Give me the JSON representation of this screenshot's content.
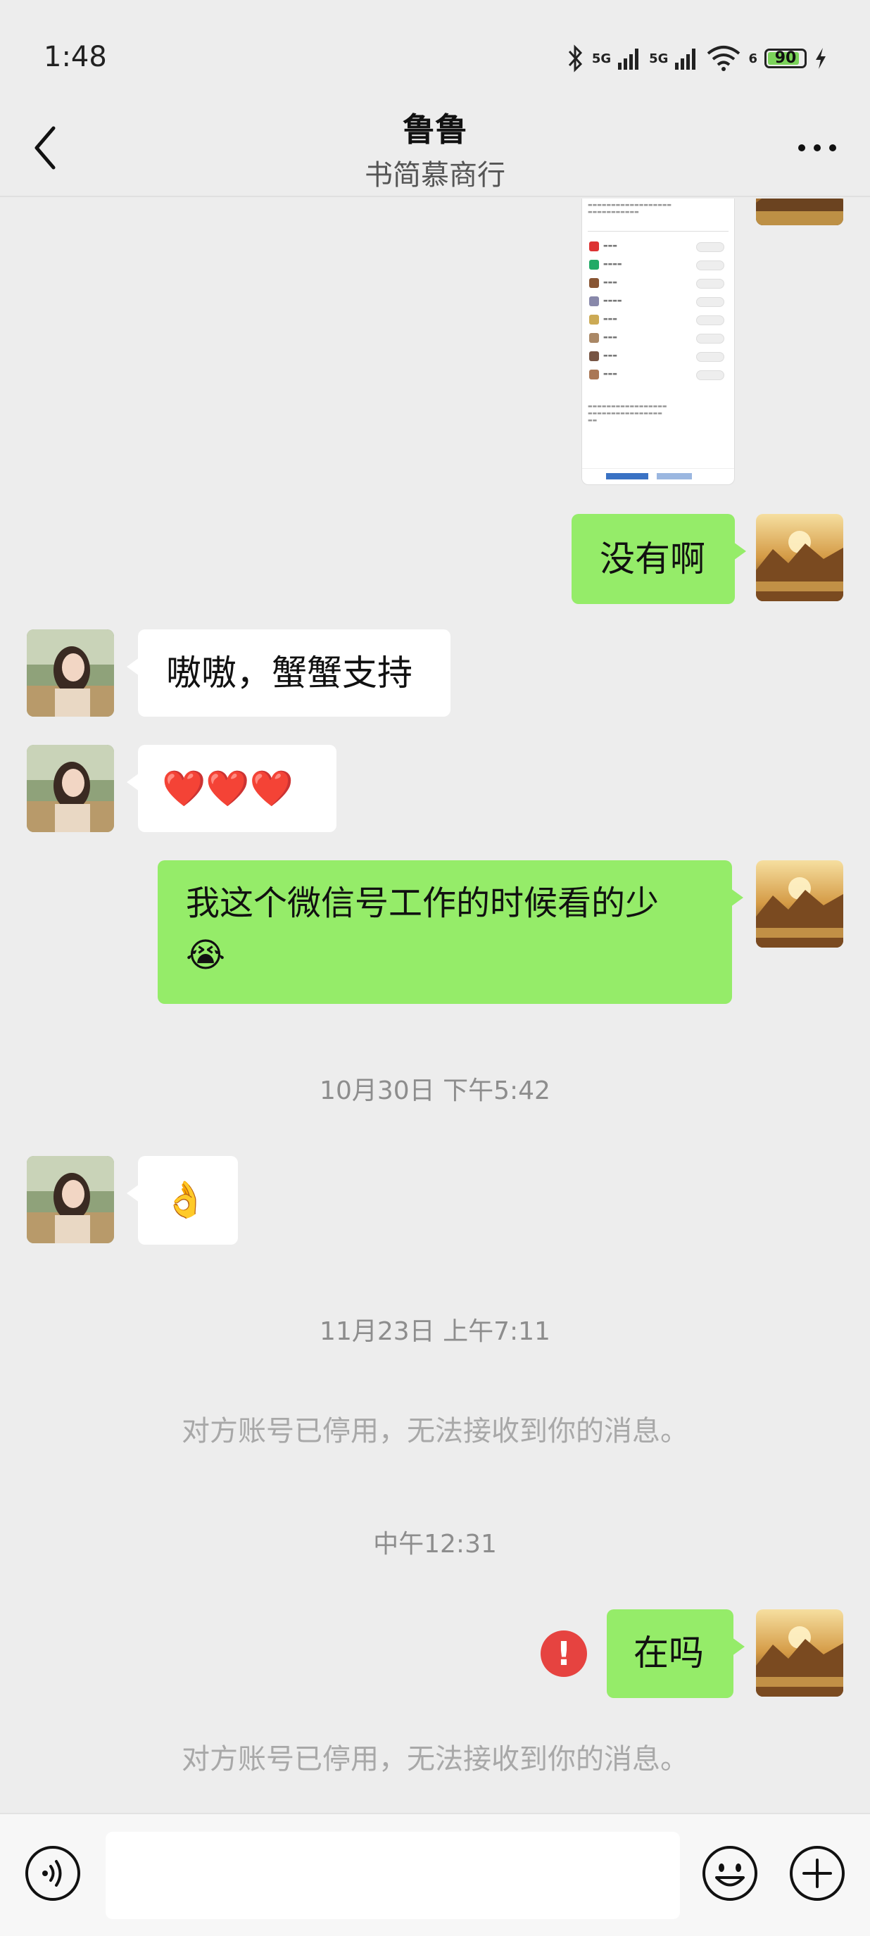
{
  "status_bar": {
    "time": "1:48",
    "signal1": "5G",
    "signal2": "5G",
    "wifi_sub": "6",
    "battery": "90"
  },
  "header": {
    "title": "鲁鲁",
    "subtitle": "书简慕商行"
  },
  "messages": {
    "m1": "没有啊",
    "m2": "嗷嗷，蟹蟹支持",
    "m3": "❤️❤️❤️",
    "m4_line1": "我这个微信号工作的时候看的少",
    "m4_emoji": "😭",
    "m5": "👌",
    "m6": "在吗"
  },
  "timestamps": {
    "t1": "10月30日 下午5:42",
    "t2": "11月23日 上午7:11",
    "t3": "中午12:31"
  },
  "system": {
    "s1": "对方账号已停用，无法接收到你的消息。",
    "s2": "对方账号已停用，无法接收到你的消息。"
  },
  "error_mark": "!",
  "input": {
    "value": ""
  },
  "icons": {
    "back": "chevron-left-icon",
    "more": "more-icon",
    "voice": "voice-icon",
    "emoji": "emoji-icon",
    "plus": "plus-icon"
  },
  "colors": {
    "bubble_me": "#95ec69",
    "bubble_them": "#ffffff",
    "background": "#ededed",
    "error": "#e64340"
  }
}
